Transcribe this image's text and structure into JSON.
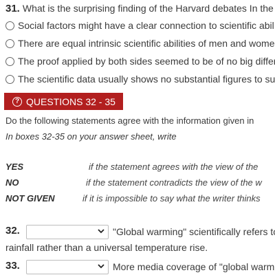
{
  "q31": {
    "number": "31.",
    "question": "What is the surprising finding of the Harvard debates In the",
    "options": [
      "Social factors might have a clear connection to scientific abil",
      "There are equal intrinsic scientific abilities of men and wome",
      "The proof applied by both sides seemed to be of no big differ",
      "The scientific data usually shows no substantial figures to su"
    ]
  },
  "banner": {
    "label": "QUESTIONS 32 - 35",
    "color": "#b21f1f"
  },
  "instructions": {
    "line1": "Do the following statements agree with the information given in",
    "line2": "In boxes 32-35 on your answer sheet, write"
  },
  "keys": [
    {
      "term": "YES",
      "desc": "if the statement agrees with the view of the"
    },
    {
      "term": "NO",
      "desc": "if the statement contradicts the view of the w"
    },
    {
      "term": "NOT GIVEN",
      "desc": "if it is impossible to say what the writer thinks"
    }
  ],
  "questions": [
    {
      "number": "32.",
      "selected": "",
      "statement": "\"Global warming\" scientifically refers to",
      "continuation": "rainfall rather than a universal temperature rise."
    },
    {
      "number": "33.",
      "selected": "",
      "statement": "More media coverage of \"global warm"
    }
  ]
}
